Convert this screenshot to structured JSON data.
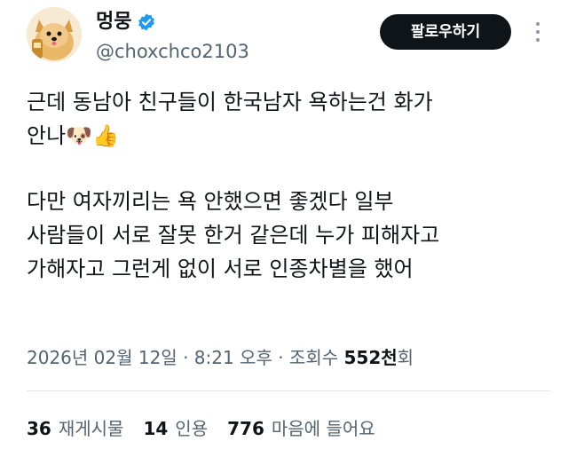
{
  "user": {
    "display_name": "멍뭉",
    "handle": "@choxchco2103",
    "avatar_icon": "pomeranian-dog-avatar"
  },
  "follow_label": "팔로우하기",
  "more_icon": "more-dots-icon",
  "tweet": {
    "lines": [
      "근데 동남아 친구들이 한국남자 욕하는건 화가",
      "안나🐶👍",
      "",
      "다만 여자끼리는 욕 안했으면 좋겠다 일부",
      "사람들이 서로 잘못 한거 같은데 누가 피해자고",
      "가해자고 그런게 없이 서로 인종차별을 했어"
    ]
  },
  "meta": {
    "timestamp": "2026년 02월 12일 · 8:21 오후 · 조회수 ",
    "views": "552천",
    "views_suffix": "회"
  },
  "stats": {
    "retweets_count": "36",
    "retweets_label": "재게시물",
    "quotes_count": "14",
    "quotes_label": "인용",
    "likes_count": "776",
    "likes_label": "마음에 들어요"
  },
  "colors": {
    "text_primary": "#0f1419",
    "text_secondary": "#536471",
    "verified_blue": "#1d9bf0",
    "button_bg": "#0f1419"
  }
}
